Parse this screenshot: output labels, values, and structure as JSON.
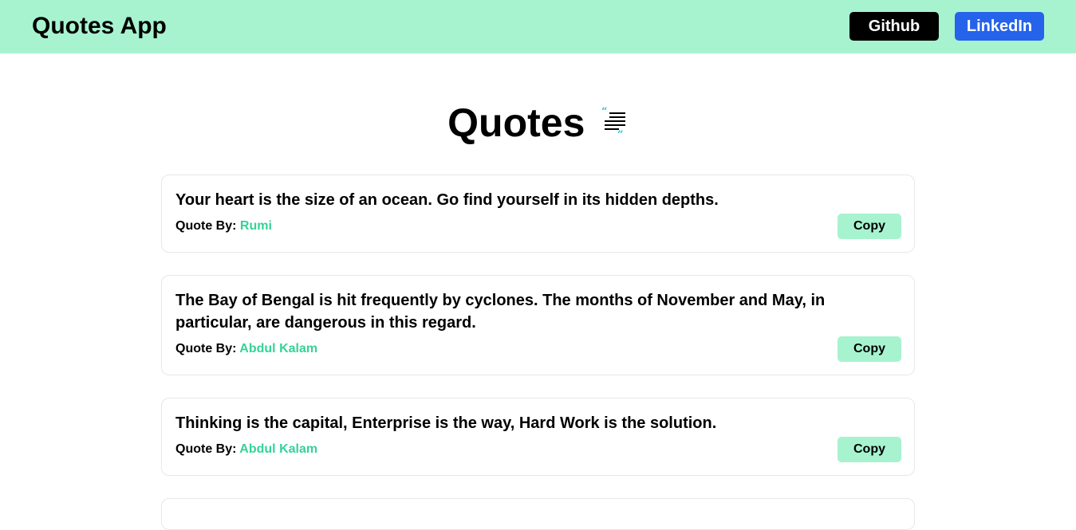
{
  "navbar": {
    "brand": "Quotes App",
    "github_label": "Github",
    "linkedin_label": "LinkedIn"
  },
  "heading": {
    "title": "Quotes",
    "icon": "quote-list-icon"
  },
  "quotes": [
    {
      "text": "Your heart is the size of an ocean. Go find yourself in its hidden depths.",
      "by_label": "Quote By: ",
      "author": "Rumi",
      "copy_label": "Copy"
    },
    {
      "text": "The Bay of Bengal is hit frequently by cyclones. The months of November and May, in particular, are dangerous in this regard.",
      "by_label": "Quote By: ",
      "author": "Abdul Kalam",
      "copy_label": "Copy"
    },
    {
      "text": "Thinking is the capital, Enterprise is the way, Hard Work is the solution.",
      "by_label": "Quote By: ",
      "author": "Abdul Kalam",
      "copy_label": "Copy"
    }
  ],
  "colors": {
    "navbar_bg": "#a7f3d0",
    "github_bg": "#000000",
    "linkedin_bg": "#2563eb",
    "author": "#34d399",
    "copy_bg": "#a7f3d0",
    "icon_accent": "#22c7d6"
  }
}
